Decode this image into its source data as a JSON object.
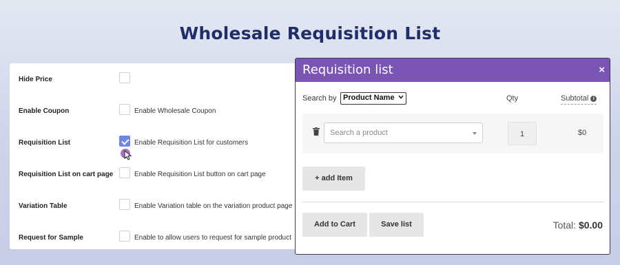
{
  "page": {
    "title": "Wholesale Requisition List"
  },
  "settings": [
    {
      "label": "Hide Price",
      "checked": false,
      "description": ""
    },
    {
      "label": "Enable Coupon",
      "checked": false,
      "description": "Enable Wholesale Coupon"
    },
    {
      "label": "Requisition List",
      "checked": true,
      "description": "Enable Requisition List for customers"
    },
    {
      "label": "Requisition List on cart page",
      "checked": false,
      "description": "Enable Requisition List button on cart page"
    },
    {
      "label": "Variation Table",
      "checked": false,
      "description": "Enable Variation table on the variation product page"
    },
    {
      "label": "Request for Sample",
      "checked": false,
      "description": "Enable to allow users to request for sample product"
    }
  ],
  "modal": {
    "title": "Requisition list",
    "close_label": "×",
    "search_by_label": "Search by",
    "search_by_value": "Product Name",
    "columns": {
      "qty": "Qty",
      "subtotal": "Subtotal"
    },
    "info_icon": "i",
    "items": [
      {
        "product_placeholder": "Search a product",
        "qty": "1",
        "subtotal": "$0"
      }
    ],
    "add_item_label": "+ add Item",
    "add_to_cart_label": "Add to Cart",
    "save_list_label": "Save list",
    "total_label": "Total:",
    "total_value": "$0.00"
  },
  "colors": {
    "accent": "#7b55b6",
    "title": "#1f2d6b",
    "checkbox": "#6f86e8"
  }
}
